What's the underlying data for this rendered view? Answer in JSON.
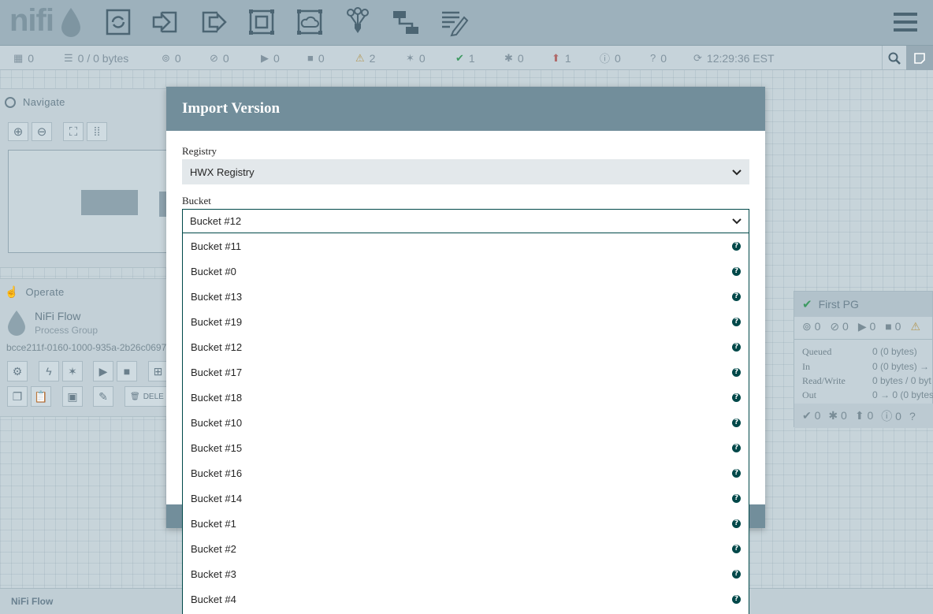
{
  "app": {
    "logo_text": "nifi"
  },
  "status": {
    "active_threads": "0",
    "queued": "0 / 0 bytes",
    "transmitting": "0",
    "not_transmitting": "0",
    "running": "0",
    "stopped": "0",
    "invalid": "2",
    "disabled": "0",
    "up_to_date": "1",
    "locally_modified": "0",
    "stale": "1",
    "locally_modified_stale": "0",
    "sync_failure": "0",
    "refresh_time": "12:29:36 EST"
  },
  "navigate": {
    "title": "Navigate"
  },
  "operate": {
    "title": "Operate",
    "name": "NiFi Flow",
    "type": "Process Group",
    "id": "bcce211f-0160-1000-935a-2b26c0697",
    "delete_label": "DELE"
  },
  "process_group": {
    "name": "First PG",
    "counts": [
      "0",
      "0",
      "0",
      "0"
    ],
    "queued_label": "Queued",
    "queued_value": "0 (0 bytes)",
    "in_label": "In",
    "in_value": "0 (0 bytes) →",
    "rw_label": "Read/Write",
    "rw_value": "0 bytes / 0 byt",
    "out_label": "Out",
    "out_value": "0 → 0 (0 bytes",
    "footer_counts": [
      "0",
      "0",
      "0",
      "0"
    ]
  },
  "footer": {
    "breadcrumb": "NiFi Flow"
  },
  "dialog": {
    "title": "Import Version",
    "registry_label": "Registry",
    "registry_value": "HWX Registry",
    "bucket_label": "Bucket",
    "bucket_value": "Bucket #12",
    "bucket_options": [
      "Bucket #11",
      "Bucket #0",
      "Bucket #13",
      "Bucket #19",
      "Bucket #12",
      "Bucket #17",
      "Bucket #18",
      "Bucket #10",
      "Bucket #15",
      "Bucket #16",
      "Bucket #14",
      "Bucket #1",
      "Bucket #2",
      "Bucket #3",
      "Bucket #4"
    ]
  }
}
